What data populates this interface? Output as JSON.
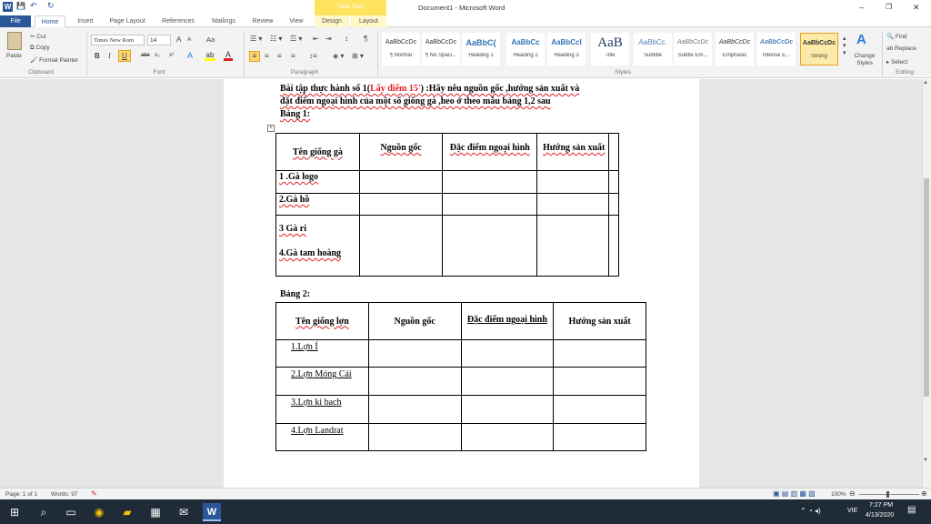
{
  "window": {
    "title": "Document1 - Microsoft Word",
    "contextual_group": "Table Tools",
    "controls": [
      "–",
      "❐",
      "✕"
    ]
  },
  "quick_access": {
    "save": "💾",
    "undo": "↶",
    "redo": "↻"
  },
  "tabs": [
    "File",
    "Home",
    "Insert",
    "Page Layout",
    "References",
    "Mailings",
    "Review",
    "View"
  ],
  "table_tabs": [
    "Design",
    "Layout"
  ],
  "ribbon": {
    "clipboard": {
      "paste": "Paste",
      "cut": "Cut",
      "copy": "Copy",
      "format_painter": "Format Painter",
      "label": "Clipboard"
    },
    "font": {
      "name": "Times New Rom",
      "size": "14",
      "bold": "B",
      "italic": "I",
      "underline": "U",
      "strike": "abc",
      "subscript": "x₂",
      "superscript": "x²",
      "grow": "A",
      "shrink": "A",
      "case": "Aa",
      "label": "Font"
    },
    "paragraph": {
      "label": "Paragraph"
    },
    "styles": {
      "label": "Styles",
      "items": [
        {
          "preview": "AaBbCcDc",
          "name": "¶ Normal"
        },
        {
          "preview": "AaBbCcDc",
          "name": "¶ No Spaci..."
        },
        {
          "preview": "AaBbC(",
          "name": "Heading 1"
        },
        {
          "preview": "AaBbCc",
          "name": "Heading 2"
        },
        {
          "preview": "AaBbCcI",
          "name": "Heading 3"
        },
        {
          "preview": "AaB",
          "name": "Title"
        },
        {
          "preview": "AaBbCc.",
          "name": "Subtitle"
        },
        {
          "preview": "AaBbCcDc",
          "name": "Subtle Em..."
        },
        {
          "preview": "AaBbCcDc",
          "name": "Emphasis"
        },
        {
          "preview": "AaBbCcDc",
          "name": "Intense E..."
        },
        {
          "preview": "AaBbCcDc",
          "name": "Strong"
        }
      ],
      "change_styles": "Change Styles"
    },
    "editing": {
      "find": "Find",
      "replace": "Replace",
      "select": "Select",
      "label": "Editing"
    }
  },
  "document": {
    "heading_a": "Bài tập thực hành số 1(",
    "heading_red": "Lấy điểm 15'",
    "heading_b": ") :Hãy nêu nguồn gốc ,hướng sản xuất và",
    "heading_line2": "đặt điểm ngoại hình của một số giống gà ,heo ở theo mẫu bảng 1,2 sau",
    "bang1": "Bảng 1:",
    "table1": {
      "headers": [
        "Tên giống gà",
        "Nguồn gốc",
        "Đặc điểm ngoại hình",
        "Hướng sản xuất"
      ],
      "rows": [
        "1 .Gà logo",
        "2.Gà hồ",
        "3 Gà ri",
        "4.Gà tam hoàng"
      ]
    },
    "bang2": "Bảng 2:",
    "table2": {
      "headers": [
        "Tên giống lợn",
        "Nguồn gốc",
        "Đặc điểm ngoại hình",
        "Hướng sản xuất"
      ],
      "rows": [
        "1.Lợn Í",
        "2.Lợn Móng Cái",
        "3.Lợn ki bach",
        "4.Lợn Landrat"
      ]
    }
  },
  "status": {
    "page": "Page: 1 of 1",
    "words": "Words: 97",
    "zoom": "100%"
  },
  "taskbar": {
    "lang": "VIE",
    "time": "7:27 PM",
    "date": "4/13/2020"
  }
}
